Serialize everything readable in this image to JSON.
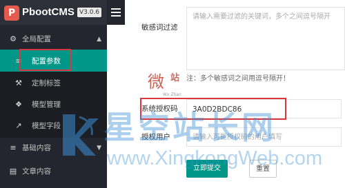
{
  "brand": {
    "name": "PbootCMS",
    "version": "V3.0.6",
    "logo_glyph": "P"
  },
  "sidebar": {
    "groups": [
      {
        "label": "全局配置",
        "icon": "settings-icon",
        "arrow": "▲"
      },
      {
        "label": "基础内容",
        "icon": "sliders-icon",
        "arrow": "▼"
      },
      {
        "label": "文章内容",
        "icon": "document-icon",
        "arrow": ""
      }
    ],
    "sub_items": [
      {
        "label": "配置参数",
        "icon": "sliders-icon",
        "active": true
      },
      {
        "label": "定制标签",
        "icon": "wrench-icon",
        "active": false
      },
      {
        "label": "模型管理",
        "icon": "cube-icon",
        "active": false
      },
      {
        "label": "模型字段",
        "icon": "external-link-icon",
        "active": false
      }
    ]
  },
  "form": {
    "sensitive_label": "敏感词过滤",
    "sensitive_placeholder": "请输入需要过滤的关键词，多个之间逗号隔开",
    "sensitive_hint": "注：多个敏感词之间用逗号隔开！",
    "license_label": "系统授权码",
    "license_value": "3A0D2BDC86",
    "user_label": "授权用户",
    "user_placeholder": "请输入可能授权码的用户填写",
    "submit_label": "立即提交",
    "reset_label": "重置"
  },
  "watermark": {
    "stamp_glyph": "微",
    "stamp_side": "站",
    "stamp_sub": "Wx Zhan",
    "site_cn": "星空站长网",
    "site_url": "www.XingkongWeb.com"
  },
  "colors": {
    "sidebar_bg": "#23262e",
    "accent": "#009688",
    "highlight_border": "#d9363e"
  }
}
